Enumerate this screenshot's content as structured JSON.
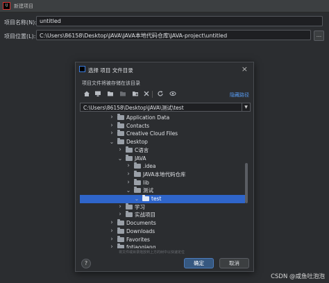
{
  "outer": {
    "logo_text": "IJ",
    "title": "新建项目",
    "name_label": "项目名称(N):",
    "name_value": "untitled",
    "location_label": "项目位置(L):",
    "location_value": "C:\\Users\\86158\\Desktop\\JAVA\\JAVA本地代码仓库\\JAVA-project\\untitled",
    "browse_label": "..."
  },
  "dialog": {
    "title": "选择 项目 文件目录",
    "close_icon": "×",
    "description": "项目文件将被存储在该目录",
    "hide_path_label": "隐藏路径",
    "path_value": "C:\\Users\\86158\\Desktop\\JAVA\\测试\\test",
    "drag_hint": "将文件或目录拖放到上方的树中以快速定位",
    "help_label": "?",
    "ok_label": "确定",
    "cancel_label": "取消",
    "toolbar_icons": [
      "home-icon",
      "desktop-icon",
      "project-folder-icon",
      "module-folder-icon",
      "new-folder-icon",
      "delete-icon",
      "refresh-icon",
      "show-hidden-icon"
    ]
  },
  "tree": [
    {
      "label": "Application Data",
      "expanded": false
    },
    {
      "label": "Contacts",
      "expanded": false
    },
    {
      "label": "Creative Cloud Files",
      "expanded": false
    },
    {
      "label": "Desktop",
      "expanded": true
    },
    {
      "label": "C语言",
      "expanded": false
    },
    {
      "label": "JAVA",
      "expanded": true
    },
    {
      "label": ".idea",
      "expanded": false
    },
    {
      "label": "JAVA本地代码仓库",
      "expanded": false
    },
    {
      "label": "lib",
      "expanded": false
    },
    {
      "label": "测试",
      "expanded": true
    },
    {
      "label": "test",
      "expanded": true,
      "selected": true
    },
    {
      "label": "学习",
      "expanded": false
    },
    {
      "label": "实战项目",
      "expanded": false
    },
    {
      "label": "Documents",
      "expanded": false
    },
    {
      "label": "Downloads",
      "expanded": false
    },
    {
      "label": "Favorites",
      "expanded": false
    },
    {
      "label": "fotiaoqiang",
      "expanded": false
    }
  ],
  "watermark": "CSDN @咸鱼吐泡泡",
  "colors": {
    "background": "#2b2d30",
    "selection": "#2f65ca",
    "link": "#589df6",
    "primary_button": "#365880"
  }
}
